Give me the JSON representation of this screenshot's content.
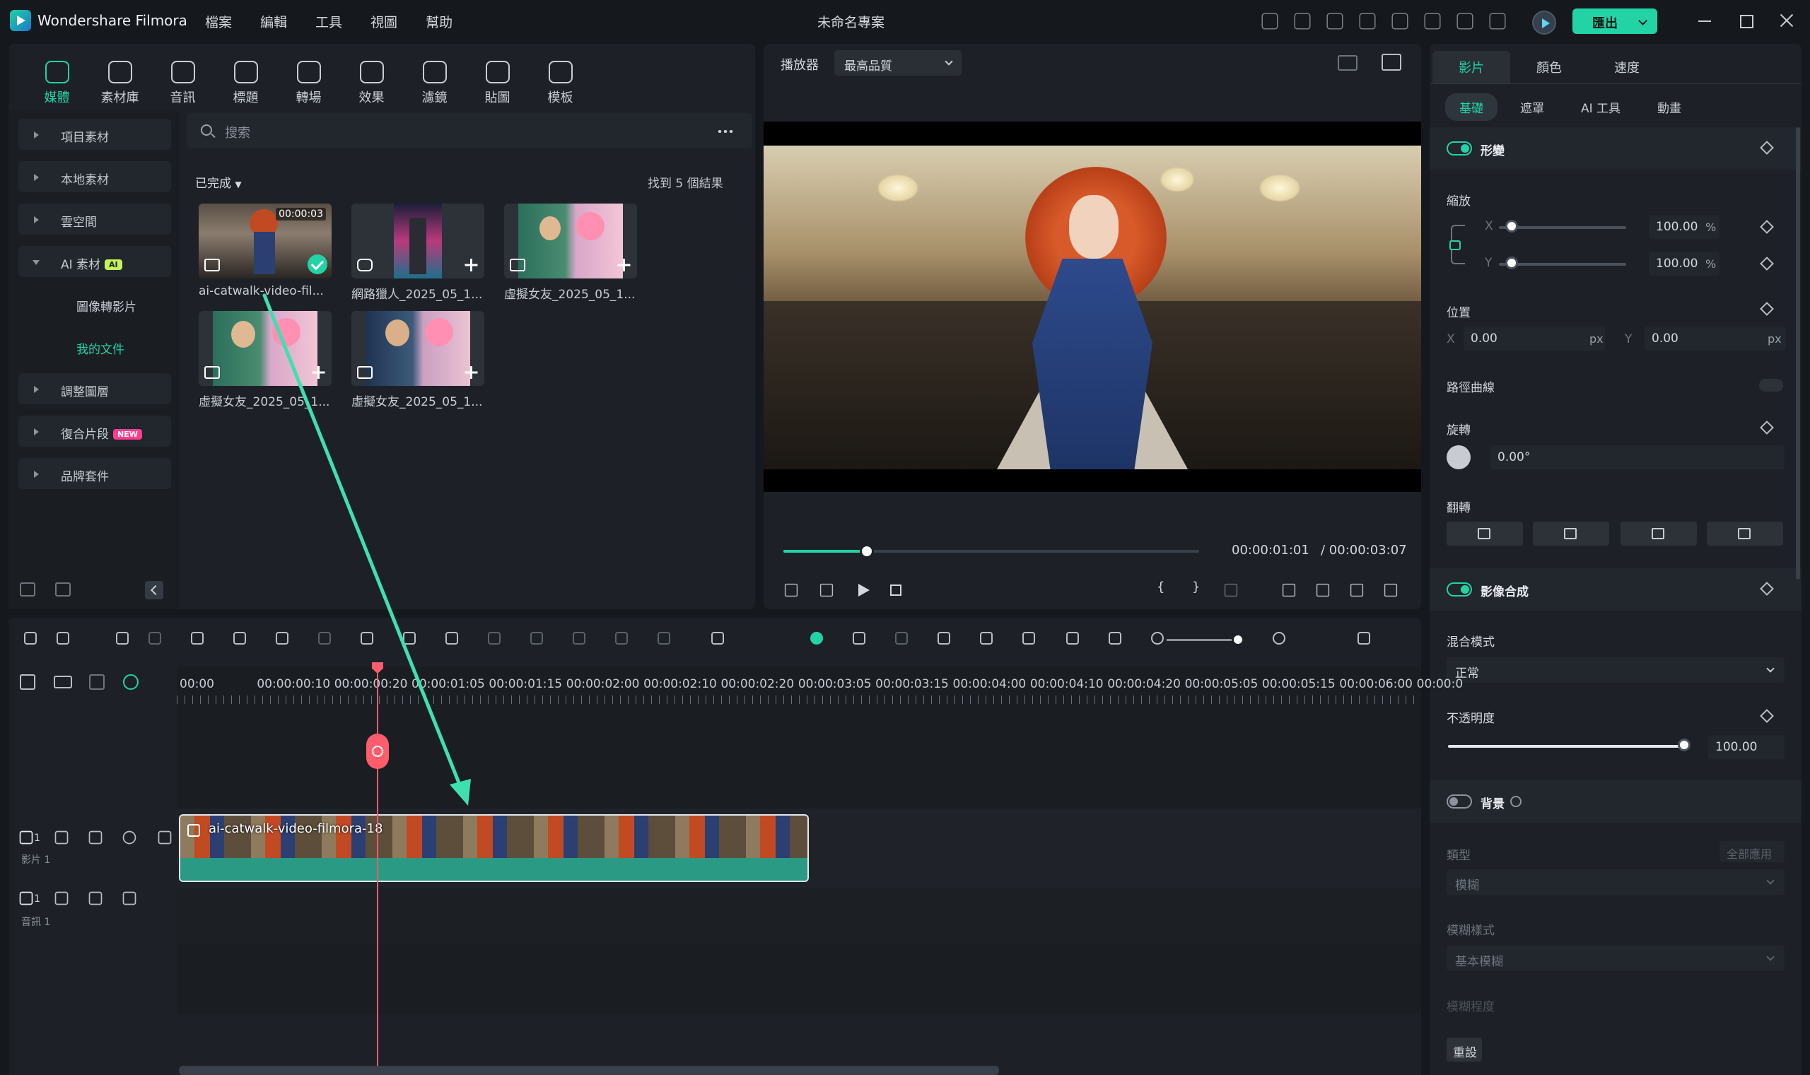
{
  "app": {
    "name": "Wondershare Filmora",
    "project_title": "未命名專案",
    "export_label": "匯出",
    "accent": "#22d3a5"
  },
  "menu": [
    "檔案",
    "編輯",
    "工具",
    "視圖",
    "幫助"
  ],
  "title_icons": [
    "gift-icon",
    "send-icon",
    "calendar-icon",
    "storage-icon",
    "save-icon",
    "cloud-icon",
    "headset-icon",
    "grid-icon"
  ],
  "library": {
    "tabs": [
      {
        "label": "媒體",
        "icon": "media-icon"
      },
      {
        "label": "素材庫",
        "icon": "store-icon"
      },
      {
        "label": "音訊",
        "icon": "music-icon"
      },
      {
        "label": "標題",
        "icon": "title-icon"
      },
      {
        "label": "轉場",
        "icon": "transition-icon"
      },
      {
        "label": "效果",
        "icon": "effects-icon"
      },
      {
        "label": "濾鏡",
        "icon": "filter-icon"
      },
      {
        "label": "貼圖",
        "icon": "sticker-icon"
      },
      {
        "label": "模板",
        "icon": "template-icon"
      }
    ],
    "sidebar": [
      {
        "label": "項目素材"
      },
      {
        "label": "本地素材"
      },
      {
        "label": "雲空間"
      },
      {
        "label": "AI 素材",
        "badge": "AI"
      },
      {
        "label": "調整圖層"
      },
      {
        "label": "復合片段",
        "badge": "NEW"
      },
      {
        "label": "品牌套件"
      }
    ],
    "sidebar_sub": [
      "圖像轉影片",
      "我的文件"
    ],
    "search_placeholder": "搜索",
    "filter_label": "已完成",
    "found_label": "找到 5 個結果",
    "items": [
      {
        "name": "ai-catwalk-video-fil...",
        "duration": "00:00:03"
      },
      {
        "name": "網路獵人_2025_05_1..."
      },
      {
        "name": "虛擬女友_2025_05_1..."
      },
      {
        "name": "虛擬女友_2025_05_1..."
      },
      {
        "name": "虛擬女友_2025_05_1..."
      }
    ]
  },
  "player": {
    "label": "播放器",
    "quality": "最高品質",
    "progress": 0.2,
    "current_time": "00:00:01:01",
    "total_time": "/ 00:00:03:07"
  },
  "properties": {
    "tabs": [
      "影片",
      "顏色",
      "速度"
    ],
    "subtabs": [
      "基礎",
      "遮罩",
      "AI 工具",
      "動畫"
    ],
    "transform": {
      "title": "形變",
      "scale_label": "縮放",
      "x_label": "X",
      "y_label": "Y",
      "scale_x": "100.00",
      "scale_y": "100.00",
      "percent": "%",
      "scale_level": 0.1,
      "position_label": "位置",
      "pos_x": "0.00",
      "pos_y": "0.00",
      "px": "px",
      "path_label": "路徑曲線",
      "rotate_label": "旋轉",
      "rotate_value": "0.00°",
      "flip_label": "翻轉"
    },
    "compositing": {
      "title": "影像合成",
      "blend_label": "混合模式",
      "blend_value": "正常",
      "opacity_label": "不透明度",
      "opacity_value": "100.00",
      "opacity_level": 1.0
    },
    "background": {
      "title": "背景",
      "type_label": "類型",
      "apply_all": "全部應用",
      "type_value": "模糊",
      "blur_style_label": "模糊樣式",
      "blur_style_value": "基本模糊",
      "blur_level_label": "模糊程度"
    },
    "reset_label": "重設"
  },
  "timeline": {
    "ruler": [
      "00:00",
      "00:00:00:10",
      "00:00:00:20",
      "00:00:01:05",
      "00:00:01:15",
      "00:00:02:00",
      "00:00:02:10",
      "00:00:02:20",
      "00:00:03:05",
      "00:00:03:15",
      "00:00:04:00",
      "00:00:04:10",
      "00:00:04:20",
      "00:00:05:05",
      "00:00:05:15",
      "00:00:06:00",
      "00:00:0"
    ],
    "video_track": {
      "index": "1",
      "name": "影片 1"
    },
    "audio_track": {
      "index": "1",
      "name": "音訊 1"
    },
    "clip_title": "ai-catwalk-video-filmora-18"
  }
}
